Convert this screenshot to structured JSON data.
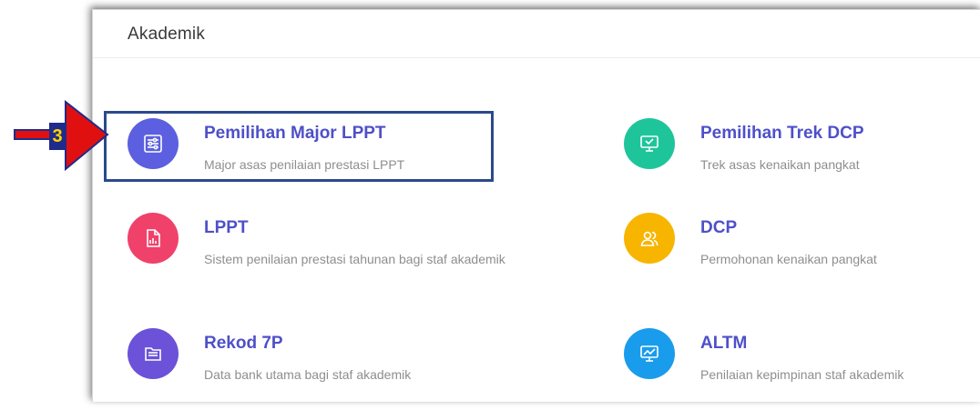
{
  "panel": {
    "title": "Akademik"
  },
  "annotation": {
    "step": "3"
  },
  "items": [
    {
      "title": "Pemilihan Major LPPT",
      "desc": "Major asas penilaian prestasi LPPT",
      "color": "#5b5fe0",
      "icon": "sliders-icon"
    },
    {
      "title": "Pemilihan Trek DCP",
      "desc": "Trek asas kenaikan pangkat",
      "color": "#1fc59a",
      "icon": "monitor-icon"
    },
    {
      "title": "LPPT",
      "desc": "Sistem penilaian prestasi tahunan bagi staf akademik",
      "color": "#f0416b",
      "icon": "document-chart-icon"
    },
    {
      "title": "DCP",
      "desc": "Permohonan kenaikan pangkat",
      "color": "#f7b500",
      "icon": "users-icon"
    },
    {
      "title": "Rekod 7P",
      "desc": "Data bank utama bagi staf akademik",
      "color": "#6b52d8",
      "icon": "folder-icon"
    },
    {
      "title": "ALTM",
      "desc": "Penilaian kepimpinan staf akademik",
      "color": "#1a9cec",
      "icon": "presentation-chart-icon"
    }
  ]
}
